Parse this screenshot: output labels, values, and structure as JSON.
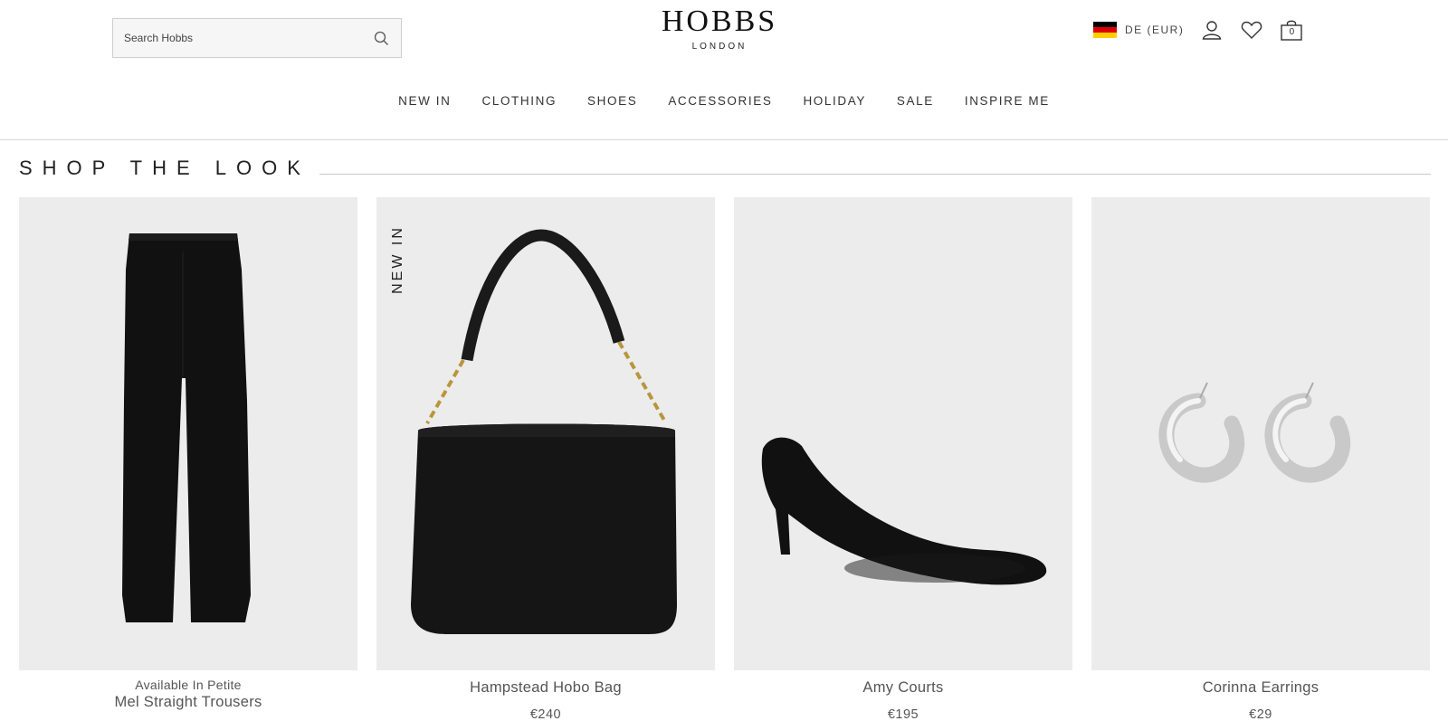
{
  "header": {
    "search_placeholder": "Search Hobbs",
    "logo_main": "HOBBS",
    "logo_sub": "LONDON",
    "region": "DE (EUR)",
    "bag_count": "0"
  },
  "nav": {
    "items": [
      "NEW IN",
      "CLOTHING",
      "SHOES",
      "ACCESSORIES",
      "HOLIDAY",
      "SALE",
      "INSPIRE ME"
    ]
  },
  "look": {
    "title": "SHOP THE LOOK",
    "products": [
      {
        "note": "Available In Petite",
        "name": "Mel Straight Trousers",
        "price": ""
      },
      {
        "badge": "NEW IN",
        "name": "Hampstead Hobo Bag",
        "price": "€240"
      },
      {
        "name": "Amy Courts",
        "price": "€195"
      },
      {
        "name": "Corinna Earrings",
        "price": "€29"
      }
    ]
  },
  "colors": {
    "image_bg": "#ececec",
    "flag_black": "#000000",
    "flag_red": "#dd0000",
    "flag_gold": "#ffce00"
  },
  "icons": [
    "search-icon",
    "account-icon",
    "wishlist-heart-icon",
    "shopping-bag-icon"
  ]
}
